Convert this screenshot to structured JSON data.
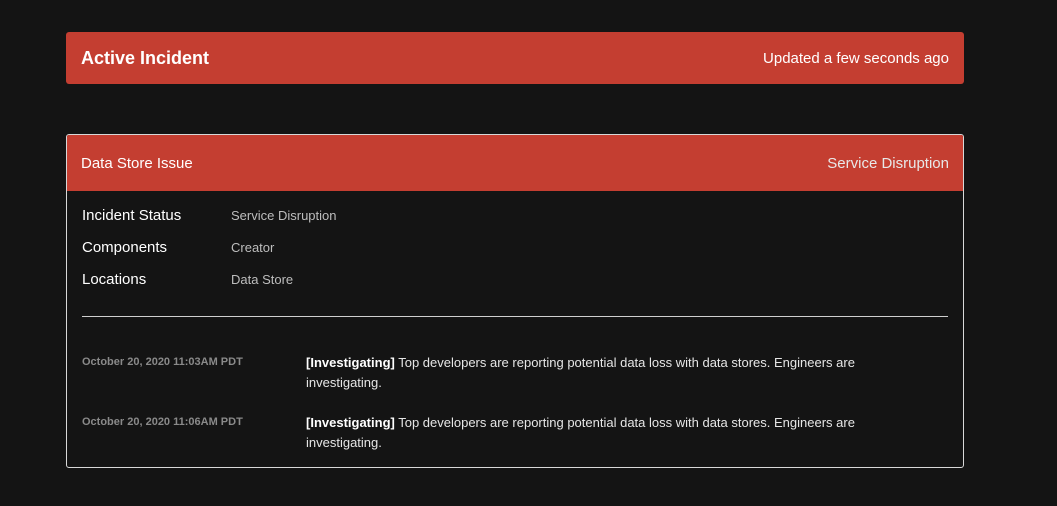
{
  "banner": {
    "title": "Active Incident",
    "updated": "Updated a few seconds ago"
  },
  "incident": {
    "title": "Data Store Issue",
    "status_label": "Service Disruption",
    "details": [
      {
        "label": "Incident Status",
        "value": "Service Disruption"
      },
      {
        "label": "Components",
        "value": "Creator"
      },
      {
        "label": "Locations",
        "value": "Data Store"
      }
    ],
    "updates": [
      {
        "time": "October 20, 2020 11:03AM PDT",
        "tag": "[Investigating]",
        "message": " Top developers are reporting potential data loss with data stores. Engineers are investigating."
      },
      {
        "time": "October 20, 2020 11:06AM PDT",
        "tag": "[Investigating]",
        "message": " Top developers are reporting potential data loss with data stores. Engineers are investigating."
      }
    ]
  },
  "colors": {
    "background": "#141414",
    "accent": "#c43e31",
    "border": "#d8d8d8"
  }
}
